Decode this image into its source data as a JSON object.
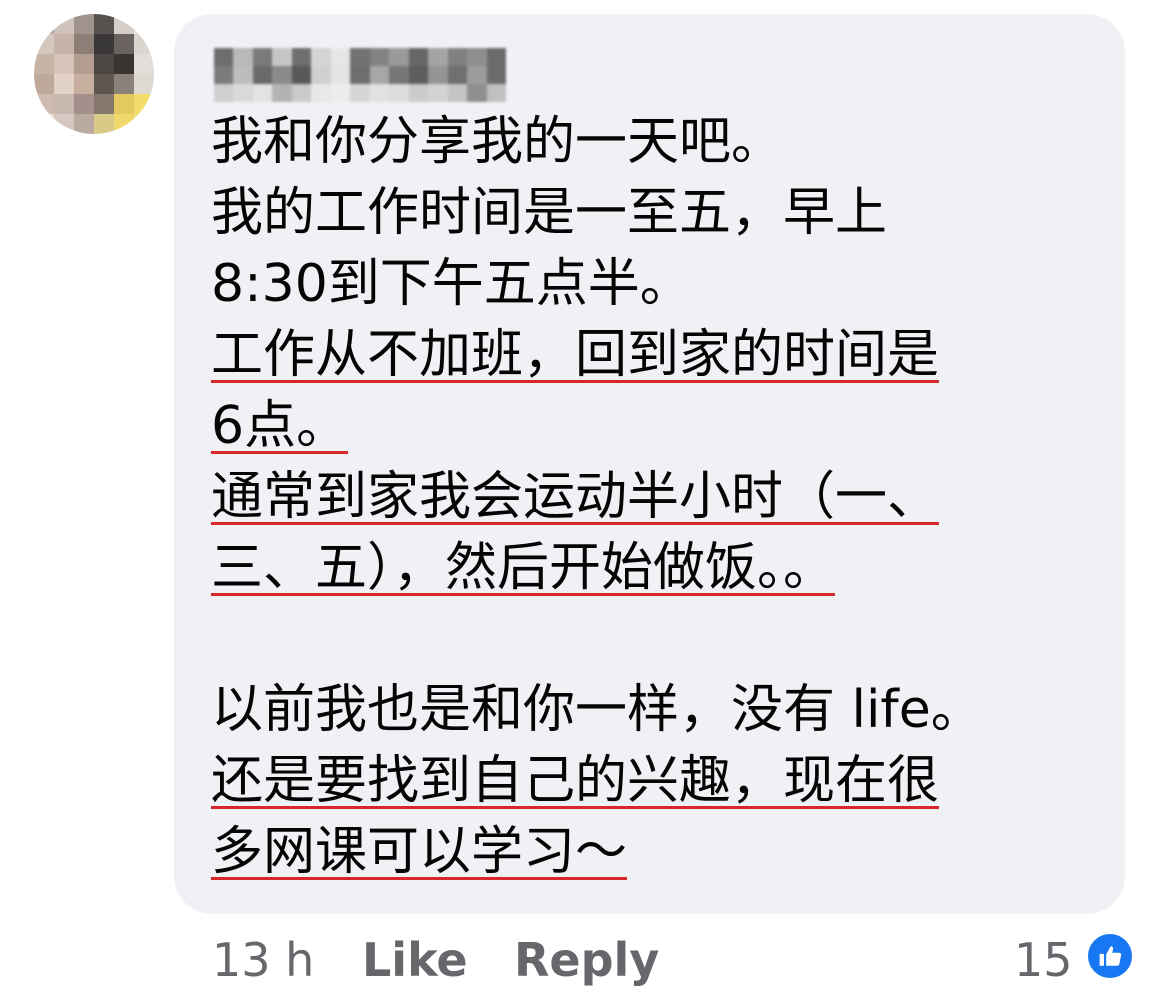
{
  "comment": {
    "lines": [
      "我和你分享我的一天吧。",
      "我的工作时间是一至五，早上",
      "8:30到下午五点半。",
      "工作从不加班，回到家的时间是",
      "6点。",
      "通常到家我会运动半小时（一、",
      "三、五），然后开始做饭。。",
      "以前我也是和你一样，没有 life。",
      "还是要找到自己的兴趣，现在很",
      "多网课可以学习～"
    ]
  },
  "footer": {
    "time": "13 h",
    "like_label": "Like",
    "reply_label": "Reply",
    "reaction_count": "15"
  },
  "colors": {
    "bubble": "#eff1f5",
    "underline": "#d8262b",
    "like_reaction": "#1877f2",
    "meta_text": "#65676b"
  },
  "icons": {
    "avatar": "pixelated-avatar",
    "author_name": "pixelated-name",
    "reaction": "thumbs-up-icon"
  }
}
